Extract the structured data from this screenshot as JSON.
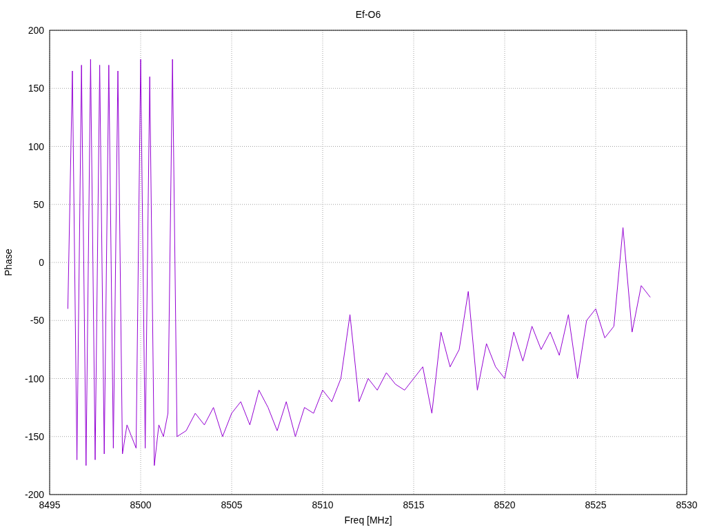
{
  "chart": {
    "chart_data": {
      "type": "line",
      "grid": true,
      "title": "Ef-O6",
      "xlabel": "Freq [MHz]",
      "ylabel": "Phase",
      "xlim": [
        8495,
        8530
      ],
      "ylim": [
        -200,
        200
      ],
      "xticks": [
        8495,
        8500,
        8505,
        8510,
        8515,
        8520,
        8525,
        8530
      ],
      "yticks": [
        -200,
        -150,
        -100,
        -50,
        0,
        50,
        100,
        150,
        200
      ],
      "x": [
        8496,
        8496.25,
        8496.5,
        8496.75,
        8497,
        8497.25,
        8497.5,
        8497.75,
        8498,
        8498.25,
        8498.5,
        8498.75,
        8499,
        8499.25,
        8499.5,
        8499.75,
        8500,
        8500.25,
        8500.5,
        8500.75,
        8501,
        8501.25,
        8501.5,
        8501.75,
        8502,
        8502.5,
        8503,
        8503.5,
        8504,
        8504.5,
        8505,
        8505.5,
        8506,
        8506.5,
        8507,
        8507.5,
        8508,
        8508.5,
        8509,
        8509.5,
        8510,
        8510.5,
        8511,
        8511.5,
        8512,
        8512.5,
        8513,
        8513.5,
        8514,
        8514.5,
        8515,
        8515.5,
        8516,
        8516.5,
        8517,
        8517.5,
        8518,
        8518.5,
        8519,
        8519.5,
        8520,
        8520.5,
        8521,
        8521.5,
        8522,
        8522.5,
        8523,
        8523.5,
        8524,
        8524.5,
        8525,
        8525.5,
        8526,
        8526.5,
        8527,
        8527.5,
        8528
      ],
      "series": [
        {
          "color": "#9400d3",
          "values": [
            -40,
            165,
            -170,
            170,
            -175,
            175,
            -170,
            170,
            -165,
            170,
            -160,
            165,
            -165,
            -140,
            -150,
            -160,
            175,
            -160,
            160,
            -175,
            -140,
            -150,
            -130,
            175,
            -150,
            -145,
            -130,
            -140,
            -125,
            -150,
            -130,
            -120,
            -140,
            -110,
            -125,
            -145,
            -120,
            -150,
            -125,
            -130,
            -110,
            -120,
            -100,
            -45,
            -120,
            -100,
            -110,
            -95,
            -105,
            -110,
            -100,
            -90,
            -130,
            -60,
            -90,
            -75,
            -25,
            -110,
            -70,
            -90,
            -100,
            -60,
            -85,
            -55,
            -75,
            -60,
            -80,
            -45,
            -100,
            -50,
            -40,
            -65,
            -55,
            30,
            -60,
            -20,
            -30
          ]
        }
      ]
    }
  }
}
